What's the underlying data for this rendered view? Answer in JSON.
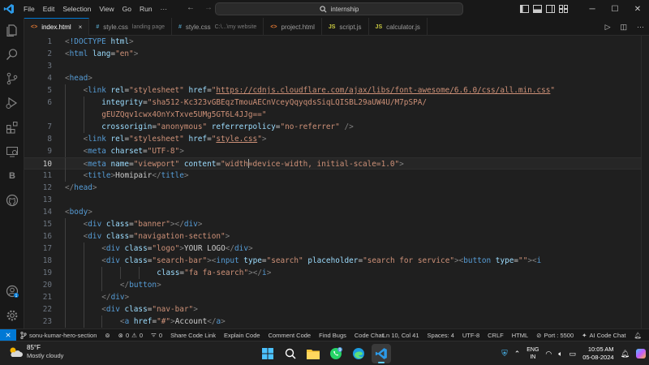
{
  "menu": [
    "File",
    "Edit",
    "Selection",
    "View",
    "Go",
    "Run"
  ],
  "more_menu": "···",
  "command_center": "internship",
  "tabs": [
    {
      "icon": "<>",
      "name": "index.html",
      "desc": "",
      "active": true,
      "close": "×",
      "color": "#e37933"
    },
    {
      "icon": "#",
      "name": "style.css",
      "desc": "landing page",
      "active": false,
      "color": "#519aba"
    },
    {
      "icon": "#",
      "name": "style.css",
      "desc": "C:\\...\\my website",
      "active": false,
      "color": "#519aba"
    },
    {
      "icon": "<>",
      "name": "project.html",
      "desc": "",
      "active": false,
      "color": "#e37933"
    },
    {
      "icon": "JS",
      "name": "script.js",
      "desc": "",
      "active": false,
      "color": "#cbcb41"
    },
    {
      "icon": "JS",
      "name": "calculator.js",
      "desc": "",
      "active": false,
      "color": "#cbcb41"
    }
  ],
  "editor": {
    "current_line": 10,
    "lines": [
      {
        "n": "1",
        "indent": 0,
        "parts": [
          [
            "t",
            "<"
          ],
          [
            "tag",
            "!DOCTYPE"
          ],
          [
            "attr",
            " html"
          ],
          [
            "t",
            ">"
          ]
        ]
      },
      {
        "n": "2",
        "indent": 0,
        "parts": [
          [
            "t",
            "<"
          ],
          [
            "tag",
            "html"
          ],
          [
            "attr",
            " lang"
          ],
          [
            "txt",
            "="
          ],
          [
            "str",
            "\"en\""
          ],
          [
            "t",
            ">"
          ]
        ]
      },
      {
        "n": "3",
        "indent": 0,
        "parts": []
      },
      {
        "n": "4",
        "indent": 0,
        "parts": [
          [
            "t",
            "<"
          ],
          [
            "tag",
            "head"
          ],
          [
            "t",
            ">"
          ]
        ]
      },
      {
        "n": "5",
        "indent": 1,
        "parts": [
          [
            "t",
            "<"
          ],
          [
            "tag",
            "link"
          ],
          [
            "attr",
            " rel"
          ],
          [
            "txt",
            "="
          ],
          [
            "str",
            "\"stylesheet\""
          ],
          [
            "attr",
            " href"
          ],
          [
            "txt",
            "="
          ],
          [
            "str",
            "\""
          ],
          [
            "stru",
            "https://cdnjs.cloudflare.com/ajax/libs/font-awesome/6.6.0/css/all.min.css"
          ],
          [
            "str",
            "\""
          ]
        ]
      },
      {
        "n": "6",
        "indent": 2,
        "parts": [
          [
            "attr",
            "integrity"
          ],
          [
            "txt",
            "="
          ],
          [
            "str",
            "\"sha512-Kc323vGBEqzTmouAECnVceyQqyqdsSiqLQISBL29aUW4U/M7pSPA/"
          ]
        ]
      },
      {
        "n": "",
        "indent": 2,
        "parts": [
          [
            "str",
            "gEUZQqv1cwx4OnYxTxve5UMg5GT6L4JJg==\""
          ]
        ]
      },
      {
        "n": "7",
        "indent": 2,
        "parts": [
          [
            "attr",
            "crossorigin"
          ],
          [
            "txt",
            "="
          ],
          [
            "str",
            "\"anonymous\""
          ],
          [
            "attr",
            " referrerpolicy"
          ],
          [
            "txt",
            "="
          ],
          [
            "str",
            "\"no-referrer\""
          ],
          [
            "t",
            " />"
          ]
        ]
      },
      {
        "n": "8",
        "indent": 1,
        "parts": [
          [
            "t",
            "<"
          ],
          [
            "tag",
            "link"
          ],
          [
            "attr",
            " rel"
          ],
          [
            "txt",
            "="
          ],
          [
            "str",
            "\"stylesheet\""
          ],
          [
            "attr",
            " href"
          ],
          [
            "txt",
            "="
          ],
          [
            "str",
            "\""
          ],
          [
            "stru",
            "style.css"
          ],
          [
            "str",
            "\""
          ],
          [
            "t",
            ">"
          ]
        ]
      },
      {
        "n": "9",
        "indent": 1,
        "parts": [
          [
            "t",
            "<"
          ],
          [
            "tag",
            "meta"
          ],
          [
            "attr",
            " charset"
          ],
          [
            "txt",
            "="
          ],
          [
            "str",
            "\"UTF-8\""
          ],
          [
            "t",
            ">"
          ]
        ]
      },
      {
        "n": "10",
        "indent": 1,
        "parts": [
          [
            "t",
            "<"
          ],
          [
            "tag",
            "meta"
          ],
          [
            "attr",
            " name"
          ],
          [
            "txt",
            "="
          ],
          [
            "str",
            "\"viewport\""
          ],
          [
            "attr",
            " content"
          ],
          [
            "txt",
            "="
          ],
          [
            "str",
            "\"width"
          ],
          [
            "cursor",
            ""
          ],
          [
            "str",
            "=device-width, initial-scale=1.0\""
          ],
          [
            "t",
            ">"
          ]
        ]
      },
      {
        "n": "11",
        "indent": 1,
        "parts": [
          [
            "t",
            "<"
          ],
          [
            "tag",
            "title"
          ],
          [
            "t",
            ">"
          ],
          [
            "txt",
            "Homipair"
          ],
          [
            "t",
            "</"
          ],
          [
            "tag",
            "title"
          ],
          [
            "t",
            ">"
          ]
        ]
      },
      {
        "n": "12",
        "indent": 0,
        "parts": [
          [
            "t",
            "</"
          ],
          [
            "tag",
            "head"
          ],
          [
            "t",
            ">"
          ]
        ]
      },
      {
        "n": "13",
        "indent": 0,
        "parts": []
      },
      {
        "n": "14",
        "indent": 0,
        "parts": [
          [
            "t",
            "<"
          ],
          [
            "tag",
            "body"
          ],
          [
            "t",
            ">"
          ]
        ]
      },
      {
        "n": "15",
        "indent": 1,
        "parts": [
          [
            "t",
            "<"
          ],
          [
            "tag",
            "div"
          ],
          [
            "attr",
            " class"
          ],
          [
            "txt",
            "="
          ],
          [
            "str",
            "\"banner\""
          ],
          [
            "t",
            "></"
          ],
          [
            "tag",
            "div"
          ],
          [
            "t",
            ">"
          ]
        ]
      },
      {
        "n": "16",
        "indent": 1,
        "parts": [
          [
            "t",
            "<"
          ],
          [
            "tag",
            "div"
          ],
          [
            "attr",
            " class"
          ],
          [
            "txt",
            "="
          ],
          [
            "str",
            "\"navigation-section\""
          ],
          [
            "t",
            ">"
          ]
        ]
      },
      {
        "n": "17",
        "indent": 2,
        "parts": [
          [
            "t",
            "<"
          ],
          [
            "tag",
            "div"
          ],
          [
            "attr",
            " class"
          ],
          [
            "txt",
            "="
          ],
          [
            "str",
            "\"logo\""
          ],
          [
            "t",
            ">"
          ],
          [
            "txt",
            "YOUR LOGO"
          ],
          [
            "t",
            "</"
          ],
          [
            "tag",
            "div"
          ],
          [
            "t",
            ">"
          ]
        ]
      },
      {
        "n": "18",
        "indent": 2,
        "parts": [
          [
            "t",
            "<"
          ],
          [
            "tag",
            "div"
          ],
          [
            "attr",
            " class"
          ],
          [
            "txt",
            "="
          ],
          [
            "str",
            "\"search-bar\""
          ],
          [
            "t",
            "><"
          ],
          [
            "tag",
            "input"
          ],
          [
            "attr",
            " type"
          ],
          [
            "txt",
            "="
          ],
          [
            "str",
            "\"search\""
          ],
          [
            "attr",
            " placeholder"
          ],
          [
            "txt",
            "="
          ],
          [
            "str",
            "\"search for service\""
          ],
          [
            "t",
            "><"
          ],
          [
            "tag",
            "button"
          ],
          [
            "attr",
            " type"
          ],
          [
            "txt",
            "="
          ],
          [
            "str",
            "\"\""
          ],
          [
            "t",
            "><"
          ],
          [
            "tag",
            "i"
          ]
        ]
      },
      {
        "n": "19",
        "indent": 5,
        "parts": [
          [
            "attr",
            "class"
          ],
          [
            "txt",
            "="
          ],
          [
            "str",
            "\"fa fa-search\""
          ],
          [
            "t",
            "></"
          ],
          [
            "tag",
            "i"
          ],
          [
            "t",
            ">"
          ]
        ]
      },
      {
        "n": "20",
        "indent": 3,
        "parts": [
          [
            "t",
            "</"
          ],
          [
            "tag",
            "button"
          ],
          [
            "t",
            ">"
          ]
        ]
      },
      {
        "n": "21",
        "indent": 2,
        "parts": [
          [
            "t",
            "</"
          ],
          [
            "tag",
            "div"
          ],
          [
            "t",
            ">"
          ]
        ]
      },
      {
        "n": "22",
        "indent": 2,
        "parts": [
          [
            "t",
            "<"
          ],
          [
            "tag",
            "div"
          ],
          [
            "attr",
            " class"
          ],
          [
            "txt",
            "="
          ],
          [
            "str",
            "\"nav-bar\""
          ],
          [
            "t",
            ">"
          ]
        ]
      },
      {
        "n": "23",
        "indent": 3,
        "parts": [
          [
            "t",
            "<"
          ],
          [
            "tag",
            "a"
          ],
          [
            "attr",
            " href"
          ],
          [
            "txt",
            "="
          ],
          [
            "str",
            "\"#\""
          ],
          [
            "t",
            ">"
          ],
          [
            "txt",
            "Account"
          ],
          [
            "t",
            "</"
          ],
          [
            "tag",
            "a"
          ],
          [
            "t",
            ">"
          ]
        ]
      }
    ]
  },
  "status": {
    "branch": "sonu-kumar-hero-section",
    "errors": "0",
    "warnings": "0",
    "info": "0",
    "items_left": [
      "Share Code Link",
      "Explain Code",
      "Comment Code",
      "Find Bugs",
      "Code Chat"
    ],
    "position": "Ln 10, Col 41",
    "spaces": "Spaces: 4",
    "encoding": "UTF-8",
    "eol": "CRLF",
    "language": "HTML",
    "port": "Port : 5500",
    "ai_chat": "AI Code Chat"
  },
  "taskbar": {
    "temp": "85°F",
    "condition": "Mostly cloudy",
    "lang_top": "ENG",
    "lang_bottom": "IN",
    "time": "10:05 AM",
    "date": "05-08-2024",
    "whatsapp_badge": "9"
  },
  "colors": {
    "accent": "#0078d4",
    "tag": "#569cd6",
    "attr": "#9cdcfe",
    "string": "#ce9178"
  }
}
